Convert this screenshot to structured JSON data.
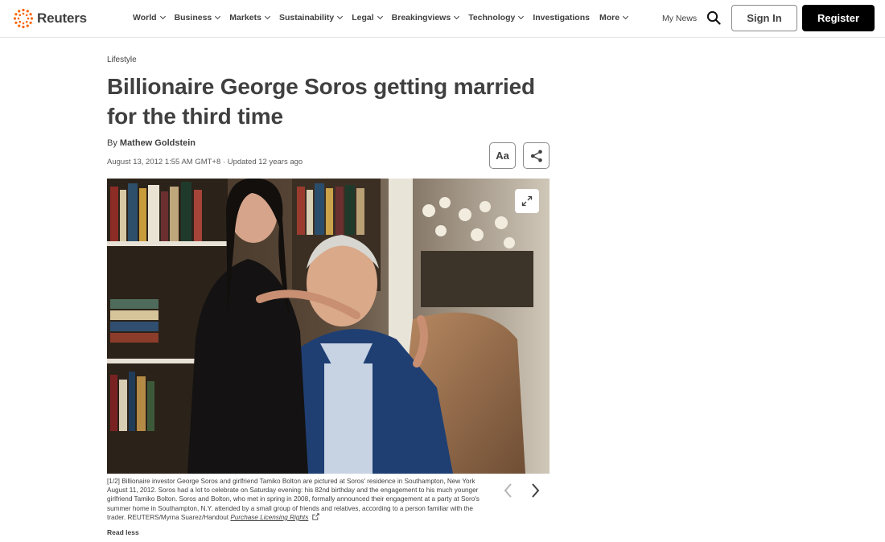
{
  "header": {
    "logo_text": "Reuters",
    "nav": [
      {
        "label": "World",
        "has_menu": true
      },
      {
        "label": "Business",
        "has_menu": true
      },
      {
        "label": "Markets",
        "has_menu": true
      },
      {
        "label": "Sustainability",
        "has_menu": true
      },
      {
        "label": "Legal",
        "has_menu": true
      },
      {
        "label": "Breakingviews",
        "has_menu": true
      },
      {
        "label": "Technology",
        "has_menu": true
      },
      {
        "label": "Investigations",
        "has_menu": false
      },
      {
        "label": "More",
        "has_menu": true
      }
    ],
    "my_news": "My News",
    "sign_in": "Sign In",
    "register": "Register",
    "accent_color": "#fa6400"
  },
  "article": {
    "kicker": "Lifestyle",
    "headline": "Billionaire George Soros getting married for the third time",
    "by_prefix": "By",
    "author": "Mathew Goldstein",
    "dateline": "August 13, 2012 1:55 AM GMT+8 · Updated 12 years ago",
    "text_size_button": "Aa"
  },
  "photo": {
    "caption": "[1/2] Billionaire investor George Soros and girlfriend Tamiko Bolton are pictured at Soros' residence in Southampton, New York August 11, 2012. Soros had a lot to celebrate on Saturday evening: his 82nd birthday and the engagement to his much younger girlfriend Tamiko Bolton. Soros and Bolton, who met in spring in 2008, formally announced their engagement at a party at Soro's summer home in Southampton, N.Y. attended by a small group of friends and relatives, according to a person familiar with the trader. REUTERS/Myrna Suarez/Handout",
    "licensing_link": "Purchase Licensing Rights",
    "read_less": "Read less"
  }
}
